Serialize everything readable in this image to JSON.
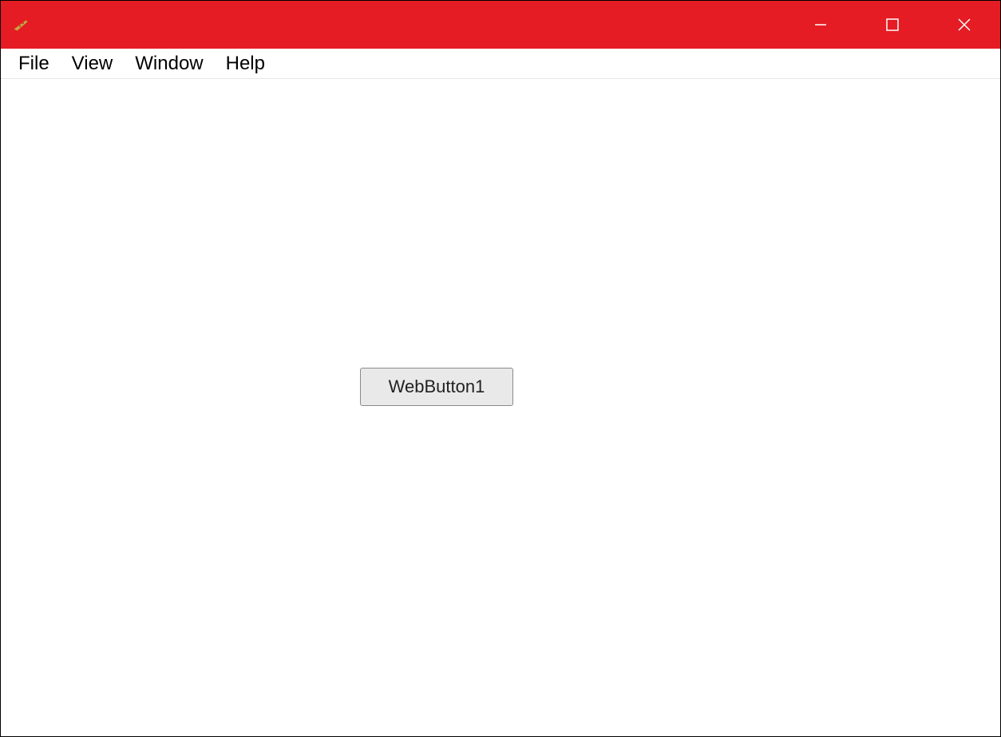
{
  "titlebar": {
    "accent_color": "#e51c23"
  },
  "menubar": {
    "items": [
      {
        "label": "File"
      },
      {
        "label": "View"
      },
      {
        "label": "Window"
      },
      {
        "label": "Help"
      }
    ]
  },
  "content": {
    "button_label": "WebButton1"
  }
}
